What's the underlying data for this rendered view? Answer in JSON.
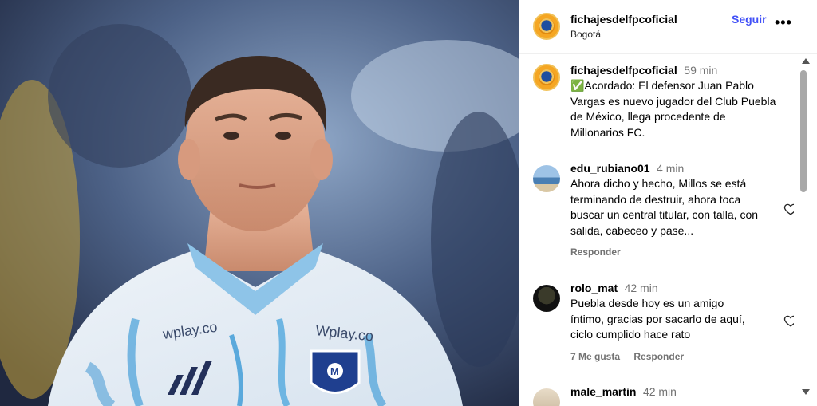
{
  "header": {
    "username": "fichajesdelfpcoficial",
    "location": "Bogotá",
    "follow_label": "Seguir",
    "more_label": "•••"
  },
  "caption": {
    "username": "fichajesdelfpcoficial",
    "time": "59 min",
    "text": "✅Acordado: El defensor Juan Pablo Vargas es nuevo jugador del Club Puebla de México, llega procedente de Millonarios FC."
  },
  "comments": [
    {
      "username": "edu_rubiano01",
      "time": "4 min",
      "text": "Ahora dicho y hecho, Millos se está terminando de destruir, ahora toca buscar un central titular, con talla, con salida, cabeceo y pase...",
      "reply_label": "Responder"
    },
    {
      "username": "rolo_mat",
      "time": "42 min",
      "text": "Puebla desde hoy es un amigo íntimo, gracias por sacarlo de aquí, ciclo cumplido hace rato",
      "likes_label": "7 Me gusta",
      "reply_label": "Responder"
    },
    {
      "username": "male_martin",
      "time": "42 min"
    }
  ],
  "photo": {
    "sponsor_text_1": "wplay.co",
    "sponsor_text_2": "Wplay.co",
    "crest_letter": "M"
  },
  "icons": {
    "heart": "heart-icon",
    "verified": "check-emoji"
  },
  "colors": {
    "follow": "#4150f7",
    "muted": "#737373"
  }
}
